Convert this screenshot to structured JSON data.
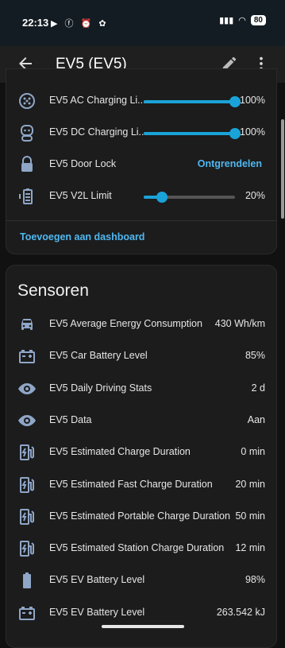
{
  "status": {
    "time": "22:13",
    "battery": "80"
  },
  "appbar": {
    "title": "EV5 (EV5)"
  },
  "controls": {
    "items": [
      {
        "name": "EV5 AC Charging Li...",
        "value": "100%",
        "level": 100
      },
      {
        "name": "EV5 DC Charging Li...",
        "value": "100%",
        "level": 100
      },
      {
        "name": "EV5 Door Lock",
        "action": "Ontgrendelen"
      },
      {
        "name": "EV5 V2L Limit",
        "value": "20%",
        "level": 20
      }
    ],
    "add_dashboard": "Toevoegen aan dashboard"
  },
  "sensors": {
    "title": "Sensoren",
    "items": [
      {
        "name": "EV5 Average Energy Consumption",
        "value": "430 Wh/km",
        "icon": "car-icon"
      },
      {
        "name": "EV5 Car Battery Level",
        "value": "85%",
        "icon": "car-battery-icon"
      },
      {
        "name": "EV5 Daily Driving Stats",
        "value": "2 d",
        "icon": "eye-icon"
      },
      {
        "name": "EV5 Data",
        "value": "Aan",
        "icon": "eye-icon"
      },
      {
        "name": "EV5 Estimated Charge Duration",
        "value": "0 min",
        "icon": "ev-station-icon"
      },
      {
        "name": "EV5 Estimated Fast Charge Duration",
        "value": "20 min",
        "icon": "ev-station-icon"
      },
      {
        "name": "EV5 Estimated Portable Charge Duration",
        "value": "50 min",
        "icon": "ev-station-icon"
      },
      {
        "name": "EV5 Estimated Station Charge Duration",
        "value": "12 min",
        "icon": "ev-station-icon"
      },
      {
        "name": "EV5 EV Battery Level",
        "value": "98%",
        "icon": "battery-icon"
      },
      {
        "name": "EV5 EV Battery Level",
        "value": "263.542 kJ",
        "icon": "car-battery-icon"
      }
    ]
  },
  "colors": {
    "accent": "#1aa3d8",
    "link": "#4fb7f0",
    "icon": "#8fa6c7"
  }
}
